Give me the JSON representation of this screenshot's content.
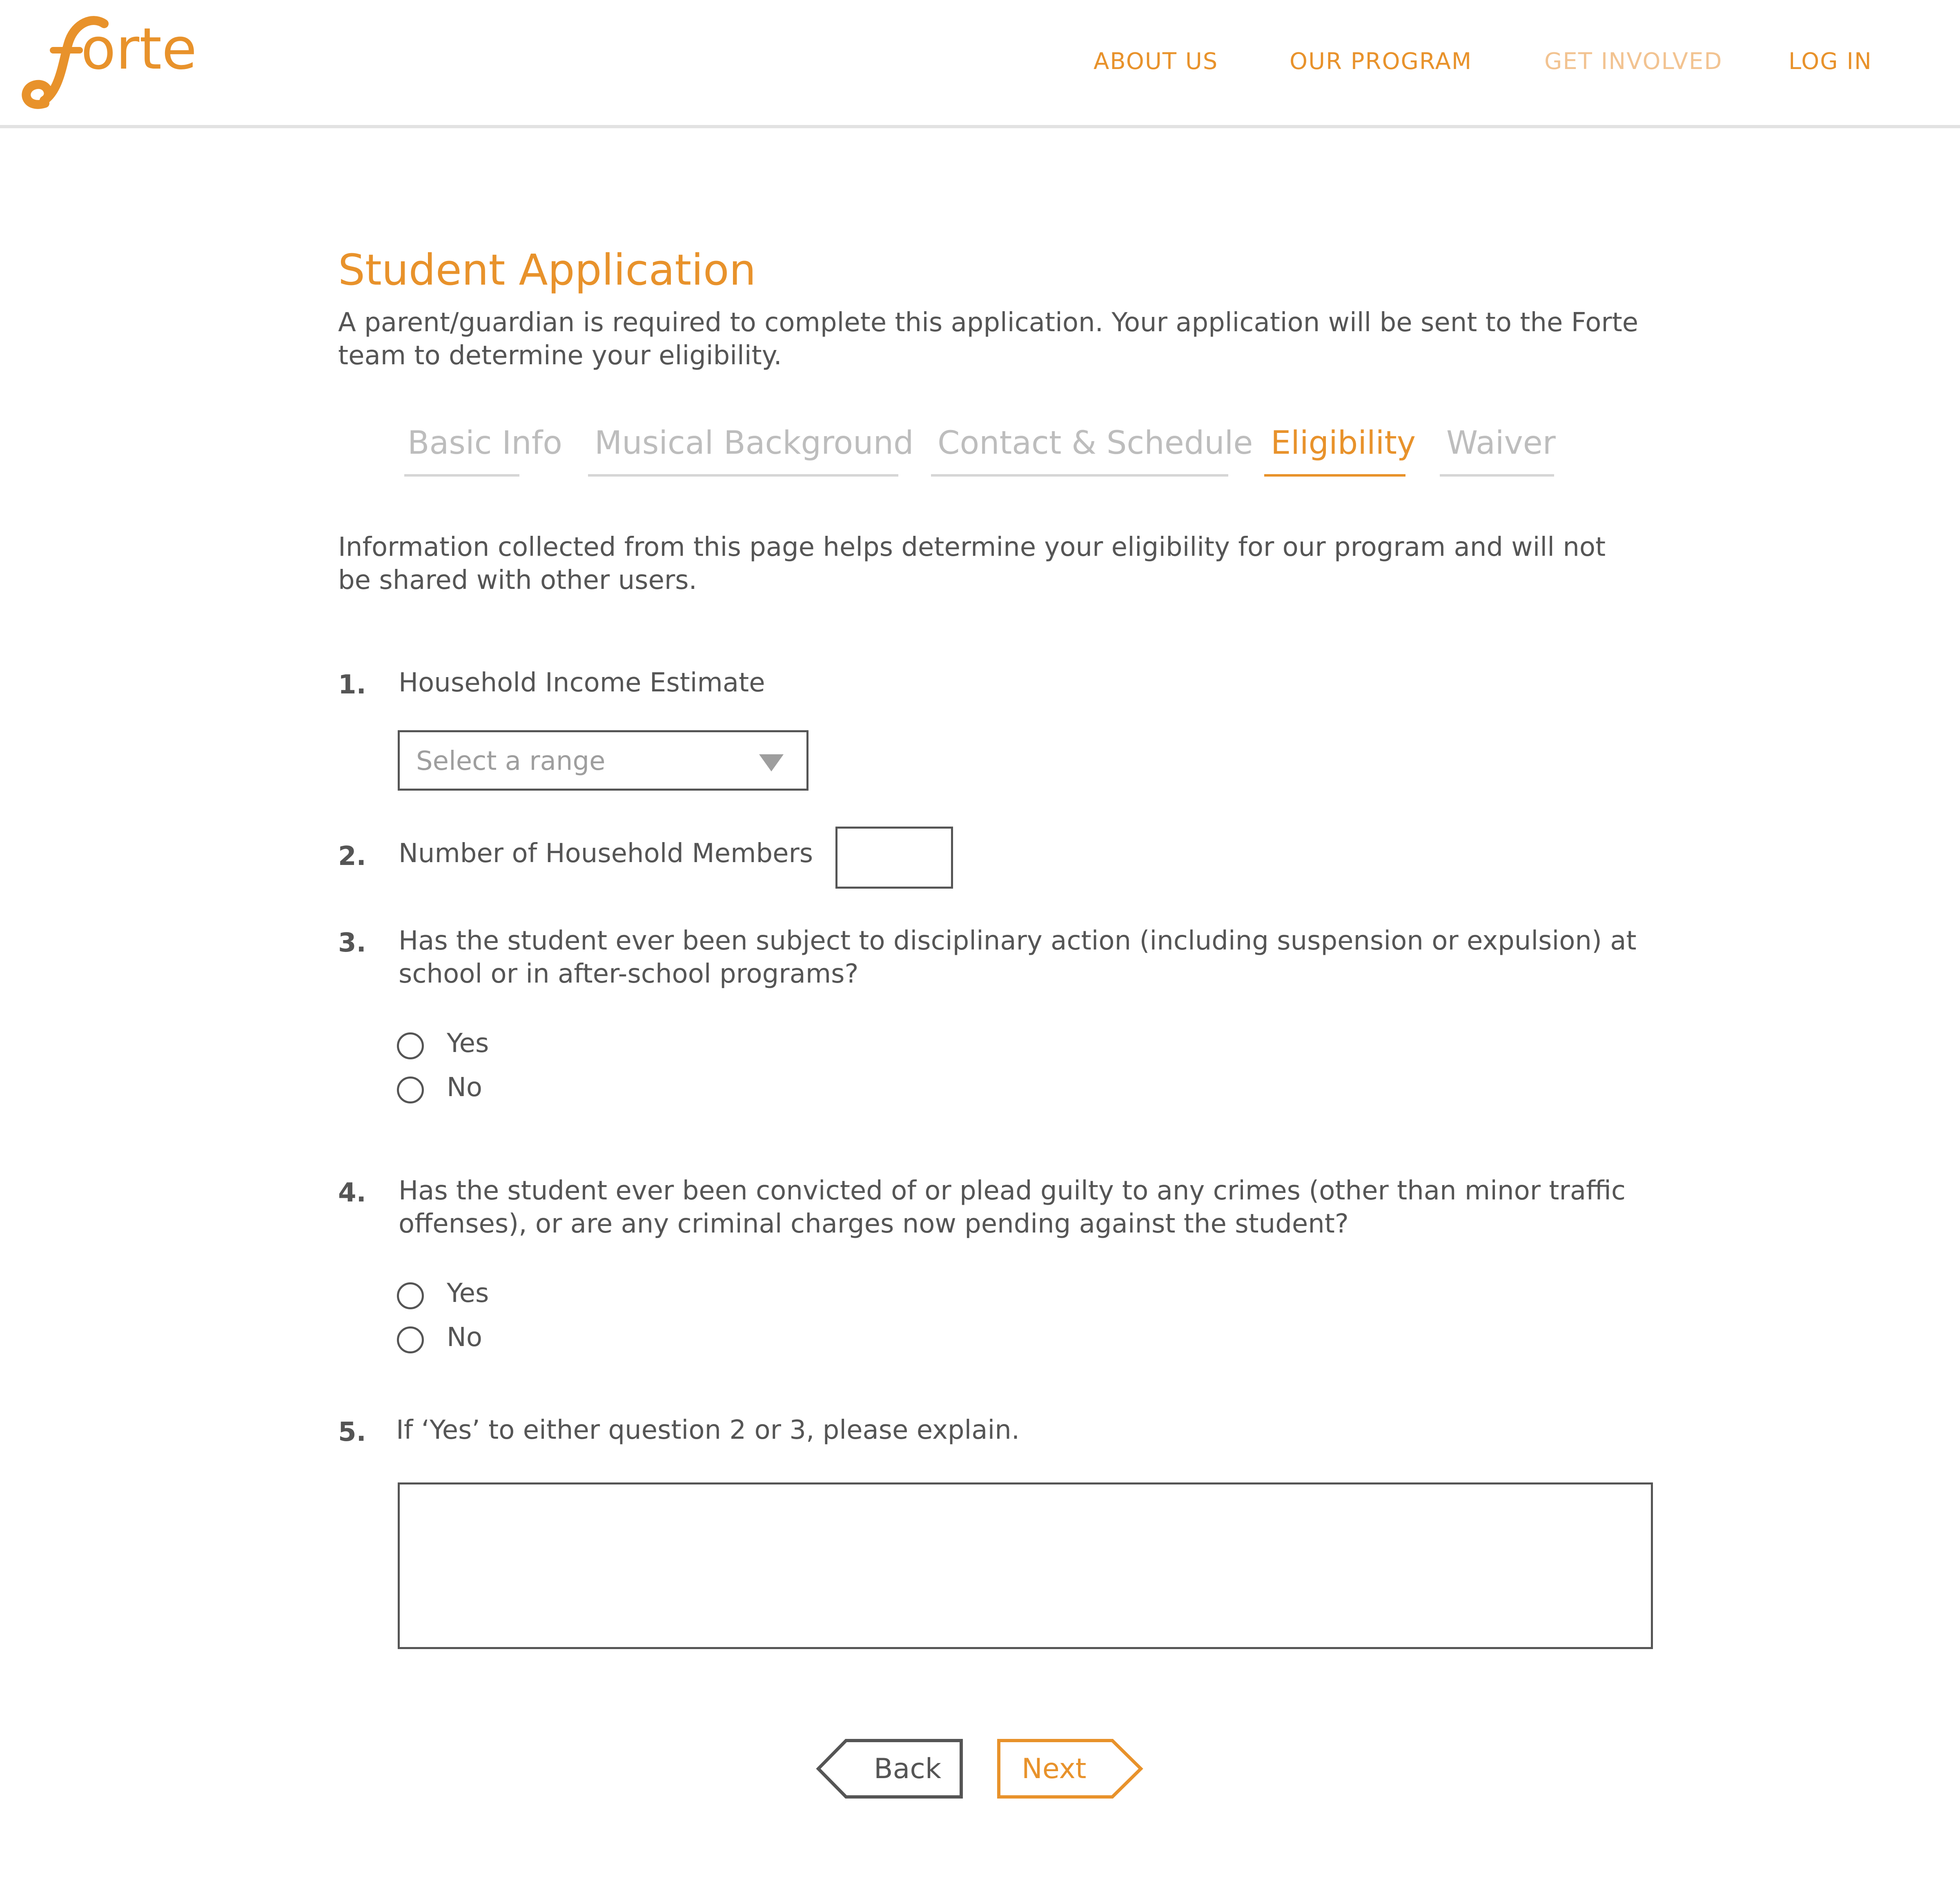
{
  "brand": {
    "logo_text": "forte",
    "accent_color": "#E8922B",
    "muted_accent_color": "#F2C391",
    "text_color": "#555555",
    "inactive_tab_color": "#BDBDBD"
  },
  "nav": {
    "items": [
      {
        "label": "ABOUT US",
        "state": "default"
      },
      {
        "label": "OUR PROGRAM",
        "state": "default"
      },
      {
        "label": "GET INVOLVED",
        "state": "faded"
      },
      {
        "label": "LOG IN",
        "state": "default"
      }
    ]
  },
  "page": {
    "title": "Student Application",
    "intro_line1": "A parent/guardian is required to complete this application. Your application will be sent to the Forte",
    "intro_line2": "team to determine your eligibility."
  },
  "tabs": [
    {
      "label": "Basic Info",
      "active": false
    },
    {
      "label": "Musical Background",
      "active": false
    },
    {
      "label": "Contact & Schedule",
      "active": false
    },
    {
      "label": "Eligibility",
      "active": true
    },
    {
      "label": "Waiver",
      "active": false
    }
  ],
  "section": {
    "notice_line1": "Information collected from this page helps determine your eligibility for our program and will not",
    "notice_line2": "be shared with other users."
  },
  "questions": {
    "q1": {
      "number": "1.",
      "text": "Household Income Estimate",
      "select_placeholder": "Select a range"
    },
    "q2": {
      "number": "2.",
      "text": "Number of Household Members",
      "value": ""
    },
    "q3": {
      "number": "3.",
      "text_line1": "Has the student ever been subject to disciplinary action (including suspension or expulsion) at",
      "text_line2": "school or in after-school programs?",
      "options": [
        "Yes",
        "No"
      ],
      "selected": null
    },
    "q4": {
      "number": "4.",
      "text_line1": "Has the student ever been convicted of or plead guilty to any crimes (other than minor traffic",
      "text_line2": "offenses), or are any criminal charges now pending against the student?",
      "options": [
        "Yes",
        "No"
      ],
      "selected": null
    },
    "q5": {
      "number": "5.",
      "text": "If ‘Yes’ to either question 2 or 3, please explain.",
      "value": ""
    }
  },
  "buttons": {
    "back_label": "Back",
    "next_label": "Next"
  }
}
